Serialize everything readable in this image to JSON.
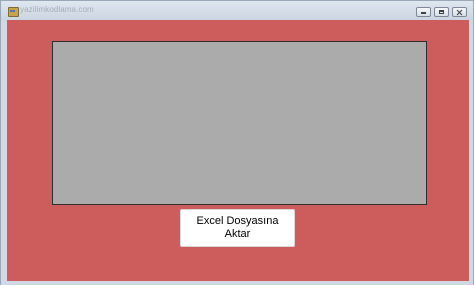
{
  "window": {
    "title": "yazilimkodlama.com",
    "controls": {
      "minimize_icon": "minimize-icon",
      "maximize_icon": "maximize-icon",
      "close_icon": "close-icon"
    }
  },
  "form": {
    "background_color": "#cd5c5c",
    "grid": {
      "background_color": "#ababab"
    },
    "export_button": {
      "label": "Excel Dosyasına Aktar"
    }
  }
}
